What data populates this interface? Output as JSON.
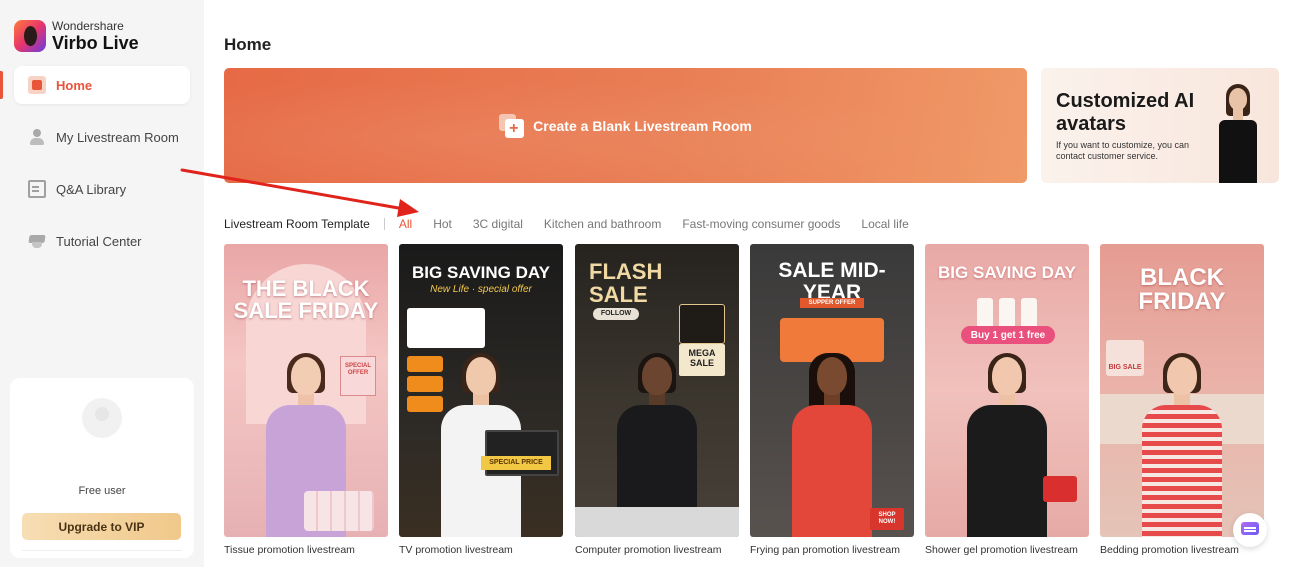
{
  "brand": {
    "company": "Wondershare",
    "product": "Virbo Live"
  },
  "sidebar": {
    "items": [
      {
        "label": "Home",
        "icon": "home-icon",
        "active": true
      },
      {
        "label": "My Livestream Room",
        "icon": "person-icon",
        "active": false
      },
      {
        "label": "Q&A Library",
        "icon": "document-icon",
        "active": false
      },
      {
        "label": "Tutorial Center",
        "icon": "graduation-cap-icon",
        "active": false
      }
    ],
    "user": {
      "plan": "Free user",
      "upgrade_label": "Upgrade to VIP"
    }
  },
  "main": {
    "title": "Home",
    "create_banner": {
      "label": "Create a Blank Livestream Room"
    },
    "avatar_card": {
      "title": "Customized AI avatars",
      "subtitle": "If you want to customize, you can contact customer service."
    },
    "templates_heading": "Livestream Room Template",
    "tabs": [
      {
        "label": "All",
        "active": true
      },
      {
        "label": "Hot",
        "active": false
      },
      {
        "label": "3C digital",
        "active": false
      },
      {
        "label": "Kitchen and bathroom",
        "active": false
      },
      {
        "label": "Fast-moving consumer goods",
        "active": false
      },
      {
        "label": "Local life",
        "active": false
      }
    ],
    "templates": [
      {
        "caption": "Tissue promotion livestream",
        "headline": "THE BLACK SALE FRIDAY",
        "sticker": "SPECIAL OFFER"
      },
      {
        "caption": "TV promotion livestream",
        "headline": "BIG SAVING DAY",
        "sticker": "SPECIAL PRICE"
      },
      {
        "caption": "Computer promotion livestream",
        "headline": "FLASH SALE",
        "sticker": "MEGA SALE"
      },
      {
        "caption": "Frying pan promotion livestream",
        "headline": "SALE MID-YEAR",
        "sticker": "SHOP NOW!"
      },
      {
        "caption": "Shower gel promotion livestream",
        "headline": "BIG SAVING DAY",
        "sticker": "Buy 1 get 1 free"
      },
      {
        "caption": "Bedding promotion livestream",
        "headline": "BLACK FRIDAY",
        "sticker": "BIG SALE"
      }
    ]
  },
  "colors": {
    "accent": "#e8553a",
    "banner": "#e66a45",
    "vip": "#f0c88a",
    "arrow": "#e0231b"
  }
}
